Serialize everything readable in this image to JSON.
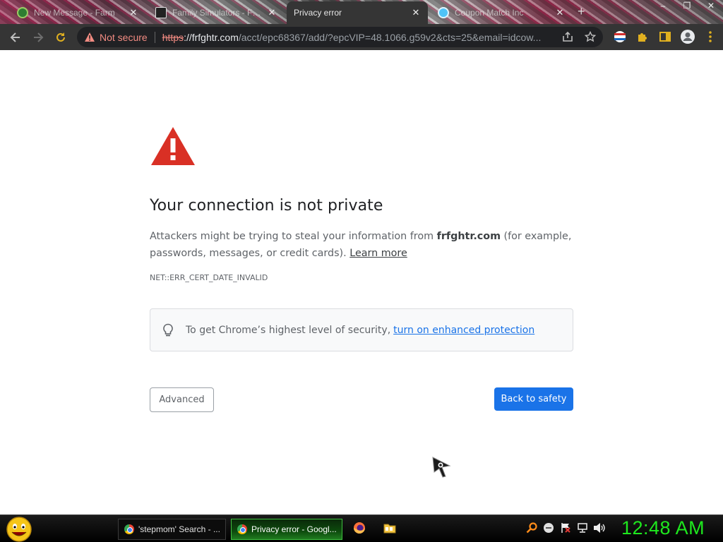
{
  "tabs": [
    {
      "title": "New Message - Farm",
      "close": "✕"
    },
    {
      "title": "Family Simulators - Free",
      "close": "✕"
    },
    {
      "title": "Privacy error",
      "close": "✕",
      "active": true
    },
    {
      "title": "Coupon Match Inc",
      "close": "✕"
    }
  ],
  "new_tab": "+",
  "window_controls": {
    "minimize": "–",
    "maximize": "❐",
    "close": "✕"
  },
  "omnibox": {
    "security_label": "Not secure",
    "scheme": "https",
    "scheme_sep": "://",
    "host": "frfghtr.com",
    "path": "/acct/epc68367/add/?epcVIP=48.1066.g59v2&cts=25&email=idcow..."
  },
  "page": {
    "heading": "Your connection is not private",
    "desc_prefix": "Attackers might be trying to steal your information from ",
    "desc_host": "frfghtr.com",
    "desc_suffix": " (for example, passwords, messages, or credit cards). ",
    "learn_more": "Learn more",
    "error_code": "NET::ERR_CERT_DATE_INVALID",
    "enhanced_text": "To get Chrome’s highest level of security,",
    "enhanced_link": "turn on enhanced protection",
    "advanced_button": "Advanced",
    "safety_button": "Back to safety"
  },
  "taskbar": {
    "tasks": [
      {
        "label": "'stepmom' Search - ..."
      },
      {
        "label": "Privacy error - Googl...",
        "active": true
      }
    ],
    "clock": "12:48 AM"
  },
  "colors": {
    "accent_blue": "#1a73e8",
    "warning_red": "#d93025",
    "clock_green": "#1ee81e"
  }
}
